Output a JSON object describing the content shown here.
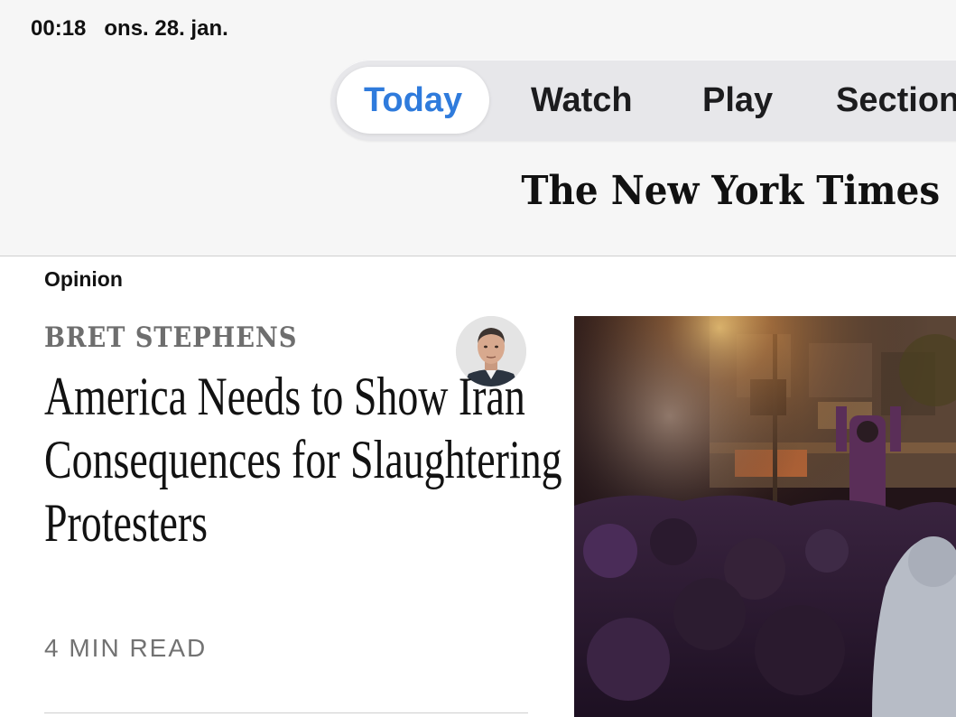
{
  "status_bar": {
    "time": "00:18",
    "date": "ons. 28. jan."
  },
  "nav": {
    "tabs": [
      {
        "label": "Today",
        "active": true
      },
      {
        "label": "Watch",
        "active": false
      },
      {
        "label": "Play",
        "active": false
      },
      {
        "label": "Section",
        "active": false
      }
    ]
  },
  "masthead": "The New York Times",
  "article": {
    "section": "Opinion",
    "author": "BRET STEPHENS",
    "headline": "America Needs to Show Iran Consequences for Slaughtering Protesters",
    "read_time": "4 MIN READ",
    "image": "night-protest-crowd-photo",
    "author_photo": "author-headshot-photo"
  },
  "colors": {
    "accent": "#2f7bdc",
    "text": "#121212",
    "muted": "#727272"
  }
}
